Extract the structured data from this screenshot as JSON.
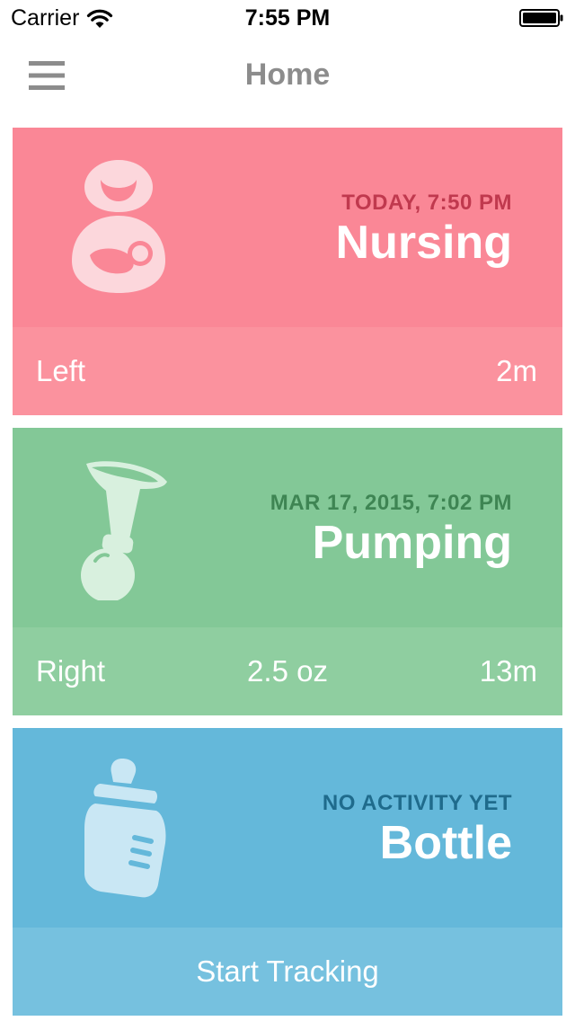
{
  "status_bar": {
    "carrier": "Carrier",
    "time": "7:55 PM"
  },
  "nav": {
    "title": "Home",
    "menu_icon": "hamburger-menu-icon"
  },
  "cards": [
    {
      "title": "Nursing",
      "last_activity": "TODAY, 7:50 PM",
      "icon": "nursing-mother-icon",
      "stats": {
        "side": "Left",
        "duration": "2m"
      },
      "colors": {
        "top": "#fa8796",
        "bottom": "#fb929e",
        "accent": "#c0394e"
      }
    },
    {
      "title": "Pumping",
      "last_activity": "MAR 17, 2015, 7:02 PM",
      "icon": "breast-pump-icon",
      "stats": {
        "side": "Right",
        "amount": "2.5 oz",
        "duration": "13m"
      },
      "colors": {
        "top": "#83c897",
        "bottom": "#8fcea0",
        "accent": "#3e8553"
      }
    },
    {
      "title": "Bottle",
      "last_activity": "NO ACTIVITY YET",
      "icon": "baby-bottle-icon",
      "action_label": "Start Tracking",
      "colors": {
        "top": "#64b8da",
        "bottom": "#76c1df",
        "accent": "#1f6b8c"
      }
    }
  ]
}
